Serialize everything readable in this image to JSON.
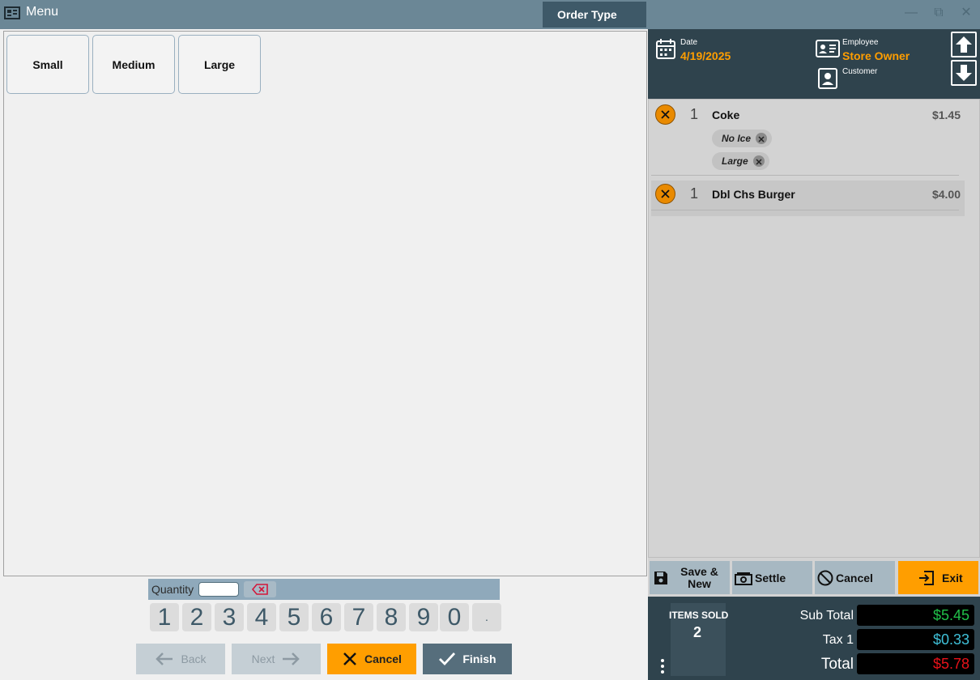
{
  "window": {
    "title": "Menu",
    "order_type": "Order Type",
    "minimize": "—",
    "restore": "⧉",
    "close": "✕"
  },
  "sizes": [
    "Small",
    "Medium",
    "Large"
  ],
  "quantity": {
    "label": "Quantity",
    "value": ""
  },
  "numpad": [
    "1",
    "2",
    "3",
    "4",
    "5",
    "6",
    "7",
    "8",
    "9",
    "0",
    "."
  ],
  "nav": {
    "back": "Back",
    "next": "Next",
    "cancel": "Cancel",
    "finish": "Finish"
  },
  "header": {
    "date_label": "Date",
    "date": "4/19/2025",
    "employee_label": "Employee",
    "employee": "Store Owner",
    "customer_label": "Customer"
  },
  "ticket": [
    {
      "qty": "1",
      "name": "Coke",
      "price": "$1.45",
      "modifiers": [
        "No Ice",
        "Large"
      ]
    },
    {
      "qty": "1",
      "name": "Dbl Chs Burger",
      "price": "$4.00",
      "modifiers": []
    }
  ],
  "actions": {
    "save": "Save & New",
    "settle": "Settle",
    "cancel": "Cancel",
    "exit": "Exit"
  },
  "totals": {
    "items_sold_label": "ITEMS SOLD",
    "items_sold": "2",
    "subtotal_label": "Sub Total",
    "subtotal": "$5.45",
    "tax_label": "Tax 1",
    "tax": "$0.33",
    "total_label": "Total",
    "total": "$5.78"
  },
  "colors": {
    "accent": "#ff9e00",
    "subtotal": "#21c24a",
    "tax": "#3fc0d8",
    "total": "#e8121a"
  }
}
